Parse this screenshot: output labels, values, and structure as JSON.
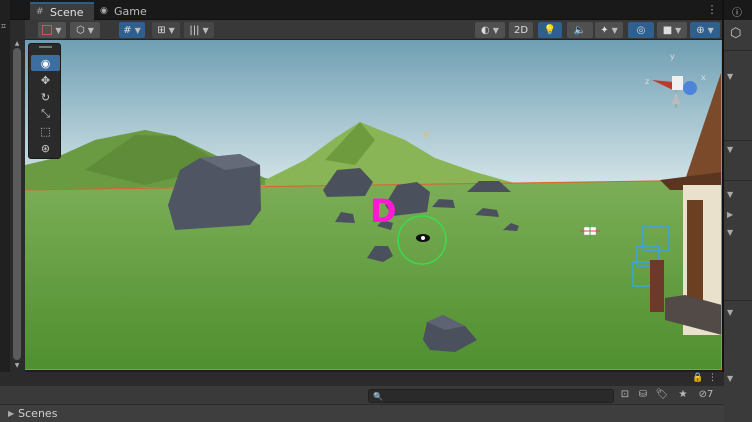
{
  "tabs": [
    {
      "label": "Scene",
      "icon": "grid-icon",
      "active": true
    },
    {
      "label": "Game",
      "icon": "gamepad-icon",
      "active": false
    }
  ],
  "toolbar": {
    "twod_label": "2D"
  },
  "tools": [
    {
      "name": "view-tool",
      "icon": "eye-icon",
      "active": true
    },
    {
      "name": "move-tool",
      "icon": "move-icon",
      "active": false
    },
    {
      "name": "rotate-tool",
      "icon": "rotate-icon",
      "active": false
    },
    {
      "name": "scale-tool",
      "icon": "scale-icon",
      "active": false
    },
    {
      "name": "rect-tool",
      "icon": "rect-icon",
      "active": false
    },
    {
      "name": "transform-tool",
      "icon": "transform-icon",
      "active": false
    }
  ],
  "viewport": {
    "marker_letter": "D",
    "gizmo_axes": {
      "y": "y",
      "z": "z",
      "x": "x"
    }
  },
  "bottom": {
    "hierarchy_label": "Scenes",
    "hidden_count": "7"
  },
  "colors": {
    "accent_blue": "#2f5f8c",
    "selection_orange": "#e07a1f",
    "marker_magenta": "#ff19d4"
  }
}
